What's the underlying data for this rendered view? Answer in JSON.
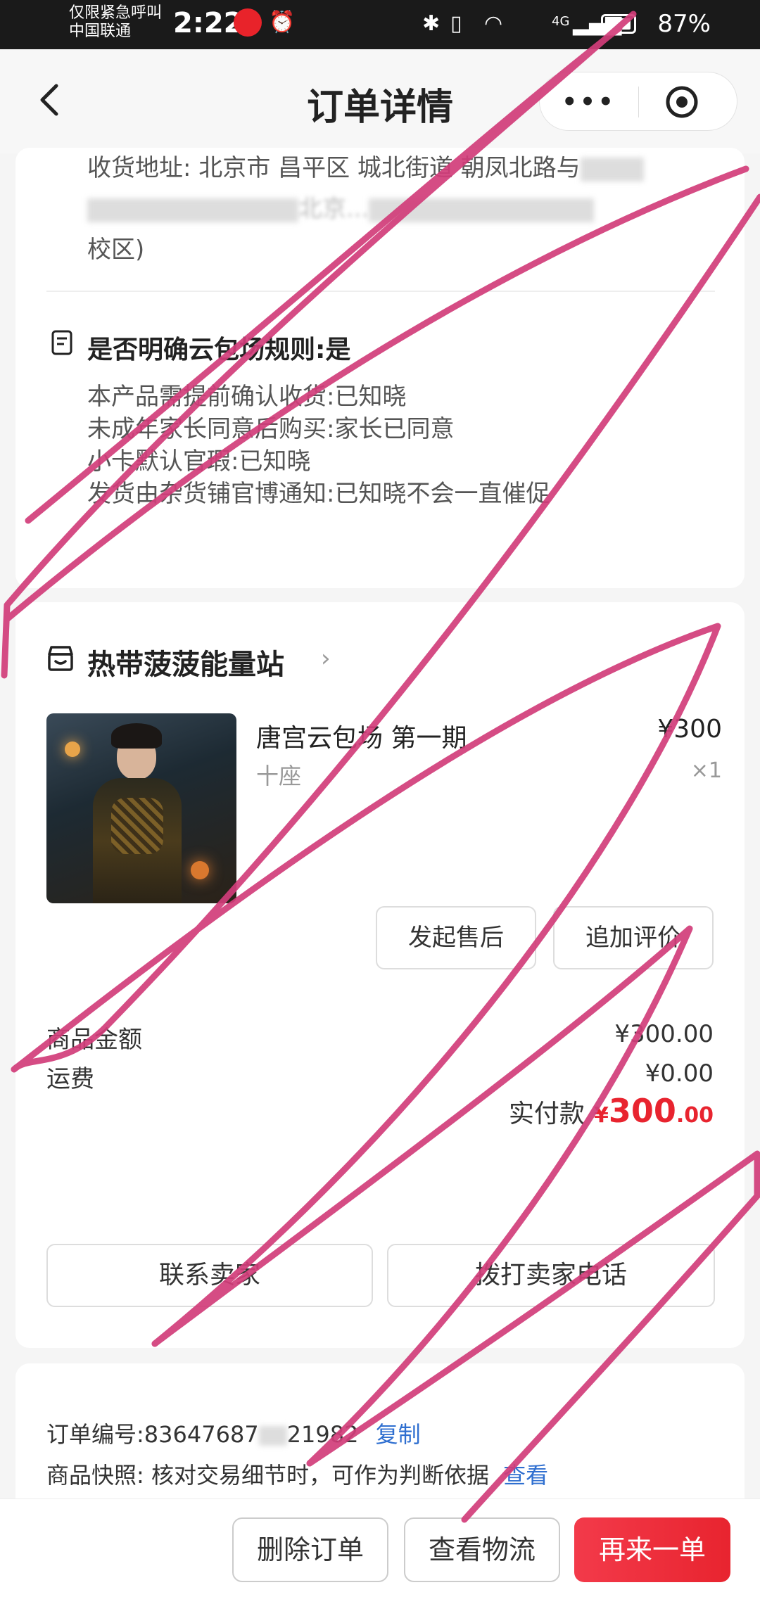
{
  "status_bar": {
    "carrier_line1": "仅限紧急呼叫",
    "carrier_line2": "中国联通",
    "time": "2:22",
    "network": "4G",
    "battery": "87%"
  },
  "nav": {
    "title": "订单详情",
    "more_icon": "more-dots-icon",
    "close_icon": "target-close-icon"
  },
  "address": {
    "line1": "收货地址: 北京市 昌平区 城北街道 朝凤北路与",
    "line2": "北京...",
    "line3": "校区)"
  },
  "rules": {
    "title": "是否明确云包场规则:是",
    "items": [
      "本产品需提前确认收货:已知晓",
      "未成年家长同意后购买:家长已同意",
      "小卡默认官瑕:已知晓",
      "发货由杂货铺官博通知:已知晓不会一直催促"
    ]
  },
  "shop": {
    "name": "热带菠菠能量站",
    "arrow": "›"
  },
  "product": {
    "title": "唐宫云包场 第一期",
    "spec": "十座",
    "price": "¥300",
    "qty": "×1"
  },
  "actions": {
    "after_sale": "发起售后",
    "add_review": "追加评价"
  },
  "summary": {
    "goods_label": "商品金额",
    "goods_value": "¥300.00",
    "shipping_label": "运费",
    "shipping_value": "¥0.00",
    "paid_label": "实付款",
    "paid_currency": "¥",
    "paid_integer": "300",
    "paid_decimal": ".00"
  },
  "contact": {
    "contact_seller": "联系卖家",
    "call_seller": "拨打卖家电话"
  },
  "order_info": {
    "order_no_label": "订单编号:",
    "order_no_value": "83647687",
    "order_no_tail": "21982",
    "copy": "复制",
    "snapshot_label": "商品快照: 核对交易细节时，可作为判断依据",
    "snapshot_link": "查看"
  },
  "bottom_bar": {
    "delete": "删除订单",
    "logistics": "查看物流",
    "reorder": "再来一单"
  },
  "colors": {
    "accent_red": "#e8242f",
    "link_blue": "#2f6fd0",
    "scribble": "#d23d7a"
  }
}
